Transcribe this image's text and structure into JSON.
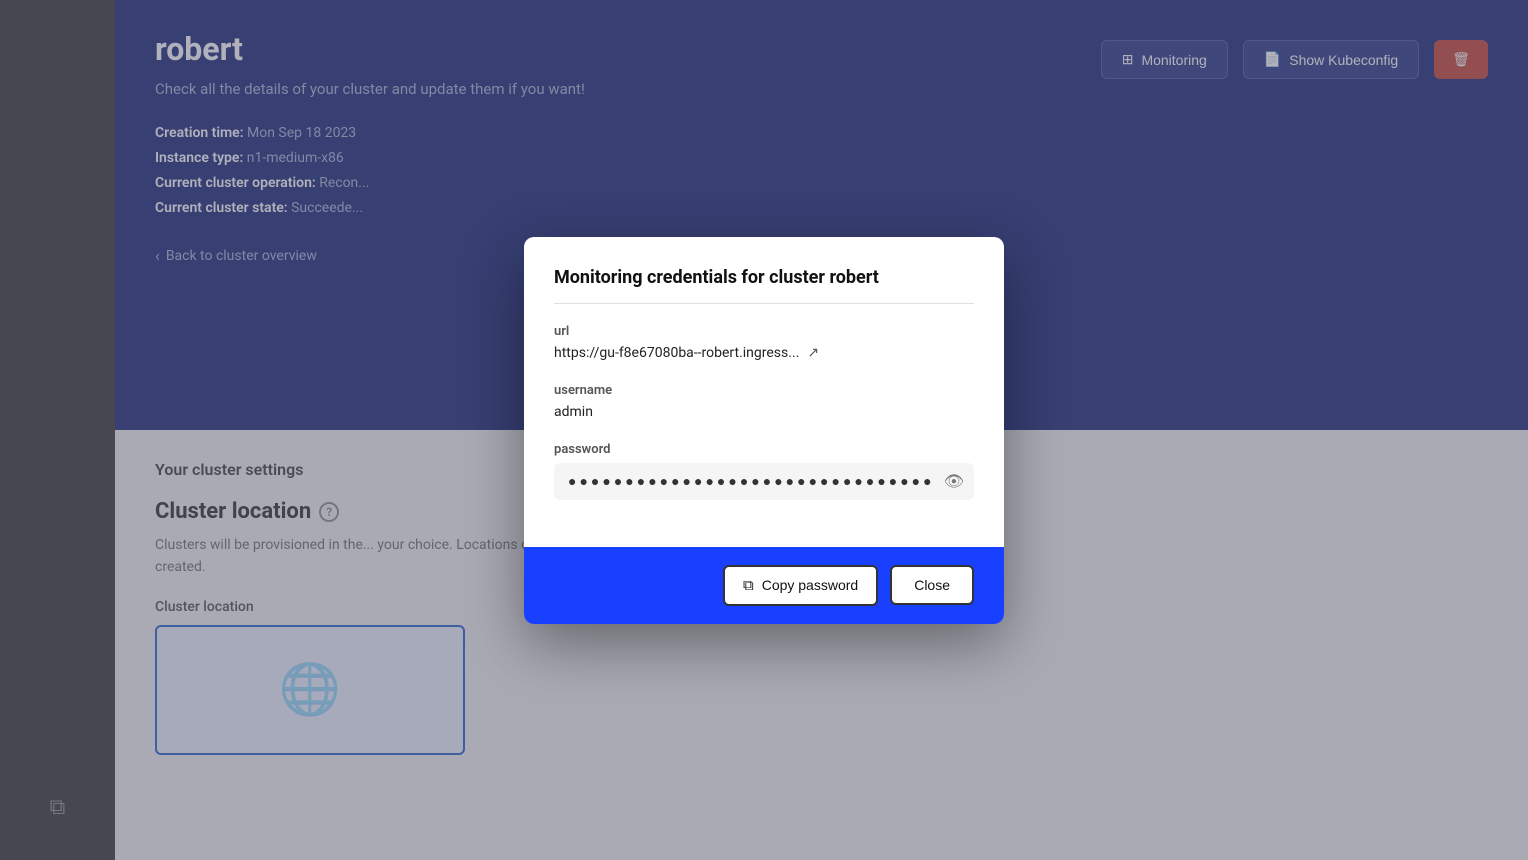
{
  "page": {
    "title": "robert"
  },
  "background": {
    "cluster_name": "robert",
    "subtitle": "Check all the details of your cluster and update them if you want!",
    "creation_time_label": "Creation time:",
    "creation_time_value": "Mon Sep 18 2023",
    "instance_type_label": "Instance type:",
    "instance_type_value": "n1-medium-x86",
    "cluster_operation_label": "Current cluster operation:",
    "cluster_operation_value": "Recon...",
    "cluster_state_label": "Current cluster state:",
    "cluster_state_value": "Succeede...",
    "back_link": "Back to cluster overview",
    "monitoring_btn": "Monitoring",
    "kubeconfig_btn": "Show Kubeconfig",
    "settings_title": "Your cluster settings",
    "cluster_location_title": "Cluster location",
    "location_description": "Clusters will be provisioned in the... your choice. Locations can't be ch... your cluster has been created.",
    "cluster_location_label": "Cluster location"
  },
  "modal": {
    "title": "Monitoring credentials for cluster robert",
    "url_label": "url",
    "url_value": "https://gu-f8e67080ba--robert.ingress...",
    "username_label": "username",
    "username_value": "admin",
    "password_label": "password",
    "password_dots": "●●●●●●●●●●●●●●●●●●●●●●●●●●●●●●●●",
    "copy_password_label": "Copy password",
    "close_label": "Close"
  },
  "icons": {
    "back_chevron": "‹",
    "external_link": "↗",
    "eye_slash": "👁",
    "copy": "⧉",
    "monitor": "⊞",
    "kubeconfig": "📄",
    "delete": "🗑",
    "sidebar_copy": "⧉",
    "info": "?"
  },
  "colors": {
    "header_bg": "#0a1a6e",
    "modal_footer_bg": "#1a40ff",
    "accent_blue": "#1a5ac8"
  }
}
